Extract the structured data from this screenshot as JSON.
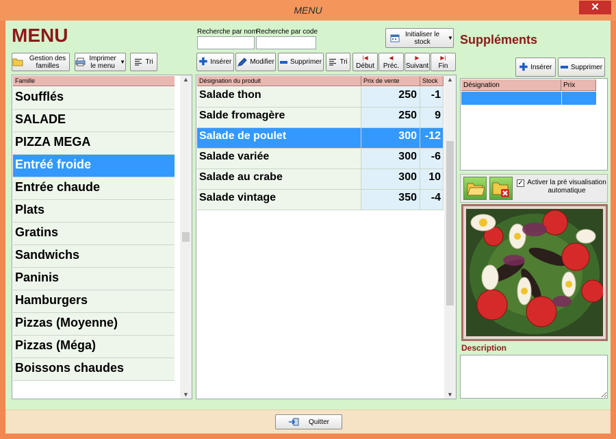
{
  "window": {
    "title": "MENU",
    "close_glyph": "✕"
  },
  "menu_heading": "MENU",
  "search": {
    "by_name_label": "Recherche par nom",
    "by_code_label": "Recherche par code",
    "by_name_value": "",
    "by_code_value": ""
  },
  "buttons": {
    "init_stock": "Initialiser le stock",
    "family_mgmt": "Gestion des familles",
    "print_menu": "Imprimer le menu",
    "sort_families": "Tri",
    "insert_product": "Insérer",
    "modify_product": "Modifier",
    "delete_product": "Supprimer",
    "sort_products": "Tri",
    "nav_first": "Début",
    "nav_prev": "Préc.",
    "nav_next": "Suivant",
    "nav_last": "Fin",
    "insert_supp": "Insérer",
    "delete_supp": "Supprimer",
    "quit": "Quitter"
  },
  "families": {
    "header": "Famille",
    "selected_index": 3,
    "items": [
      "Soufflés",
      "SALADE",
      "PIZZA MEGA",
      "Entréé froide",
      "Entrée chaude",
      "Plats",
      "Gratins",
      "Sandwichs",
      "Paninis",
      "Hamburgers",
      "Pizzas (Moyenne)",
      "Pizzas (Méga)",
      "Boissons chaudes"
    ]
  },
  "products": {
    "columns": [
      "Désignation du produit",
      "Prix de vente",
      "Stock"
    ],
    "selected_index": 2,
    "rows": [
      {
        "name": "Salade thon",
        "price": "250",
        "stock": "-1"
      },
      {
        "name": "Salde fromagère",
        "price": "250",
        "stock": "9"
      },
      {
        "name": "Salade de poulet",
        "price": "300",
        "stock": "-12"
      },
      {
        "name": "Salade variée",
        "price": "300",
        "stock": "-6"
      },
      {
        "name": "Salade au crabe",
        "price": "300",
        "stock": "10"
      },
      {
        "name": "Salade vintage",
        "price": "350",
        "stock": "-4"
      }
    ]
  },
  "supplements": {
    "heading": "Suppléments",
    "columns": [
      "Désignation",
      "Prix"
    ]
  },
  "preview": {
    "auto_preview_label": "Activer la pré visualisation automatique",
    "auto_preview_checked": true,
    "check_glyph": "✓"
  },
  "description": {
    "heading": "Description",
    "value": ""
  },
  "colors": {
    "heading": "#8b1a1a",
    "selection": "#3399ff",
    "window_frame": "#f2874f",
    "client_bg": "#d5f3cc",
    "header_cell": "#e9b8b0"
  },
  "icons": {
    "family_mgmt": "folder-icon",
    "print_menu": "printer-icon",
    "sort": "align-left-icon",
    "insert": "plus-icon",
    "modify": "pen-icon",
    "delete": "minus-icon",
    "nav_first": "first-page-icon",
    "nav_prev": "previous-icon",
    "nav_next": "next-icon",
    "nav_last": "last-page-icon",
    "init_stock": "calendar-icon",
    "open_image": "open-folder-icon",
    "remove_image": "delete-folder-icon",
    "quit": "exit-door-icon"
  }
}
